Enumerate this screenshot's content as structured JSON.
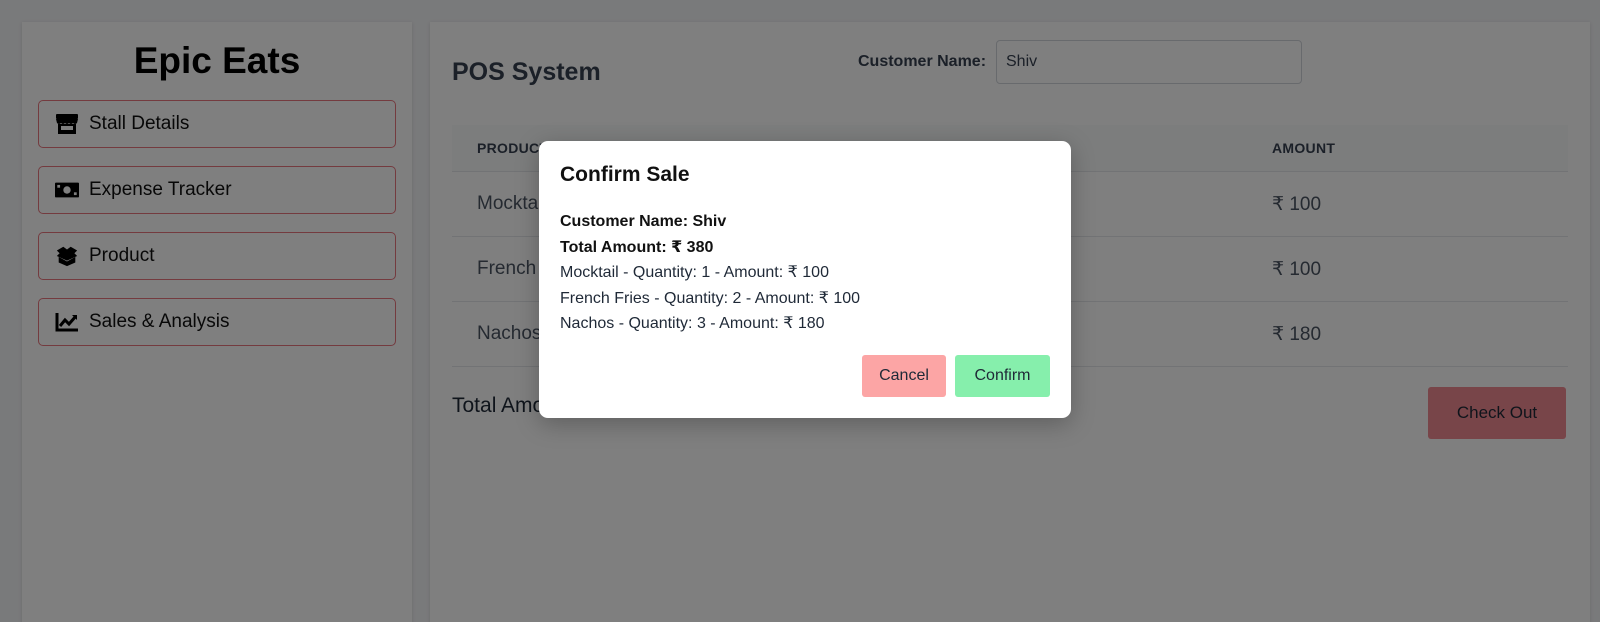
{
  "brand": "Epic Eats",
  "sidebar": {
    "items": [
      {
        "label": "Stall Details",
        "icon": "store-icon"
      },
      {
        "label": "Expense Tracker",
        "icon": "money-bill-icon"
      },
      {
        "label": "Product",
        "icon": "box-open-icon"
      },
      {
        "label": "Sales & Analysis",
        "icon": "chart-line-icon"
      }
    ]
  },
  "main": {
    "title": "POS System",
    "customer_label": "Customer Name:",
    "customer_value": "Shiv",
    "table": {
      "headers": {
        "product": "PRODUCT",
        "amount": "AMOUNT"
      },
      "rows": [
        {
          "product": "Mocktail",
          "amount": "₹ 100"
        },
        {
          "product": "French Fries",
          "amount": "₹ 100"
        },
        {
          "product": "Nachos",
          "amount": "₹ 180"
        }
      ]
    },
    "total_amount": "Total Amount: ₹ 380",
    "checkout_label": "Check Out"
  },
  "modal": {
    "title": "Confirm Sale",
    "customer_line": "Customer Name: Shiv",
    "total_line": "Total Amount: ₹ 380",
    "items": [
      "Mocktail - Quantity: 1 - Amount: ₹ 100",
      "French Fries - Quantity: 2 - Amount: ₹ 100",
      "Nachos - Quantity: 3 - Amount: ₹ 180"
    ],
    "cancel_label": "Cancel",
    "confirm_label": "Confirm"
  },
  "colors": {
    "nav_border": "#e9767f",
    "checkout": "#f08b92",
    "cancel": "#fca5a5",
    "confirm": "#86efac"
  }
}
